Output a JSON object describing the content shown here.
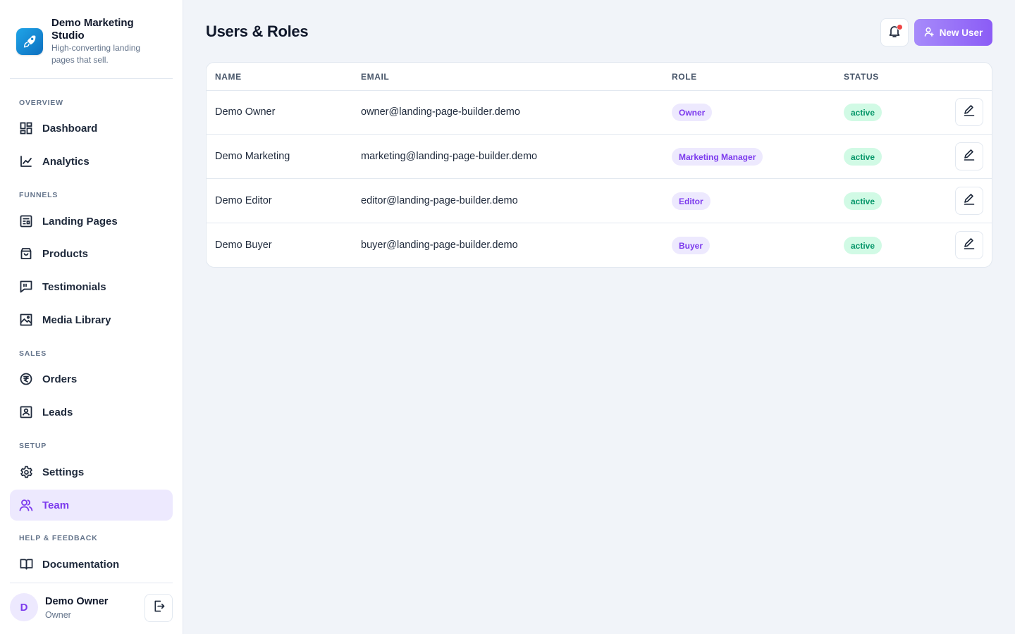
{
  "brand": {
    "name": "Demo Marketing Studio",
    "tagline": "High-converting landing pages that sell."
  },
  "sidebar": {
    "sections": [
      {
        "label": "OVERVIEW",
        "items": [
          {
            "label": "Dashboard",
            "icon": "dashboard-icon"
          },
          {
            "label": "Analytics",
            "icon": "chart-line-icon"
          }
        ]
      },
      {
        "label": "FUNNELS",
        "items": [
          {
            "label": "Landing Pages",
            "icon": "page-layout-icon"
          },
          {
            "label": "Products",
            "icon": "shopping-bag-icon"
          },
          {
            "label": "Testimonials",
            "icon": "quote-message-icon"
          },
          {
            "label": "Media Library",
            "icon": "image-icon"
          }
        ]
      },
      {
        "label": "SALES",
        "items": [
          {
            "label": "Orders",
            "icon": "rupee-icon"
          },
          {
            "label": "Leads",
            "icon": "contact-card-icon"
          }
        ]
      },
      {
        "label": "SETUP",
        "items": [
          {
            "label": "Settings",
            "icon": "gear-icon"
          },
          {
            "label": "Team",
            "icon": "users-icon",
            "active": true
          }
        ]
      },
      {
        "label": "HELP & FEEDBACK",
        "items": [
          {
            "label": "Documentation",
            "icon": "book-icon"
          }
        ]
      }
    ]
  },
  "current_user": {
    "initial": "D",
    "name": "Demo Owner",
    "role": "Owner"
  },
  "header": {
    "title": "Users & Roles",
    "new_user_label": "New User"
  },
  "table": {
    "columns": [
      "NAME",
      "EMAIL",
      "ROLE",
      "STATUS"
    ],
    "rows": [
      {
        "name": "Demo Owner",
        "email": "owner@landing-page-builder.demo",
        "role": "Owner",
        "status": "active"
      },
      {
        "name": "Demo Marketing",
        "email": "marketing@landing-page-builder.demo",
        "role": "Marketing Manager",
        "status": "active"
      },
      {
        "name": "Demo Editor",
        "email": "editor@landing-page-builder.demo",
        "role": "Editor",
        "status": "active"
      },
      {
        "name": "Demo Buyer",
        "email": "buyer@landing-page-builder.demo",
        "role": "Buyer",
        "status": "active"
      }
    ]
  },
  "colors": {
    "accent": "#7c3aed",
    "accent_light": "#ede9fe",
    "success": "#059669",
    "success_light": "#d1fae5",
    "notification": "#ef4444",
    "background": "#f1f4f9"
  }
}
